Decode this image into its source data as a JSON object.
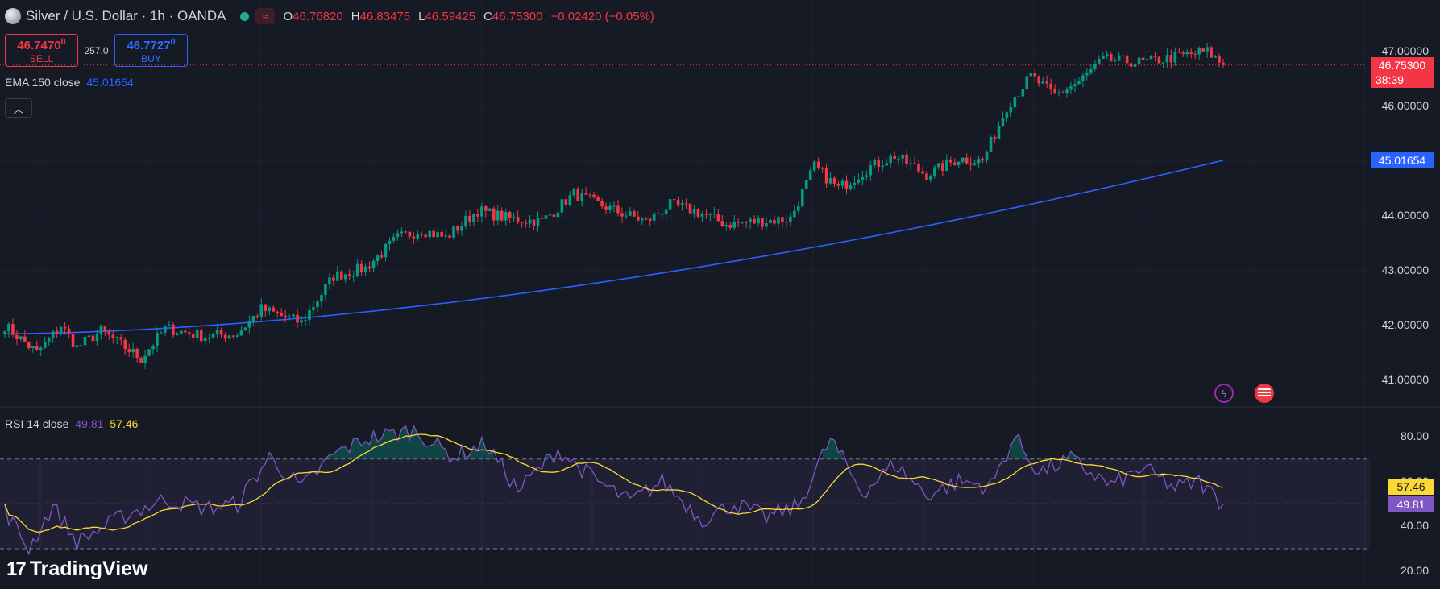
{
  "header": {
    "symbol_title": "Silver / U.S. Dollar · 1h · OANDA",
    "ohlc": [
      {
        "k": "O",
        "v": "46.76820"
      },
      {
        "k": "H",
        "v": "46.83475"
      },
      {
        "k": "L",
        "v": "46.59425"
      },
      {
        "k": "C",
        "v": "46.75300"
      }
    ],
    "change": "−0.02420 (−0.05%)",
    "market_icon": "market-open-dot",
    "data_icon": "delayed-data-icon"
  },
  "trade": {
    "sell_price": "46.7470",
    "sell_price_small": "0",
    "sell_label": "SELL",
    "spread": "257.0",
    "buy_price": "46.7727",
    "buy_price_small": "0",
    "buy_label": "BUY"
  },
  "ema": {
    "label": "EMA 150 close",
    "value": "45.01654"
  },
  "rsi": {
    "label": "RSI 14 close",
    "value": "49.81",
    "ma_value": "57.46"
  },
  "price_axis": [
    "47.00000",
    "46.00000",
    "45.00000",
    "44.00000",
    "43.00000",
    "42.00000",
    "41.00000"
  ],
  "rsi_axis": [
    "80.00",
    "60.00",
    "40.00",
    "20.00"
  ],
  "last_price_badge": {
    "price": "46.75300",
    "countdown": "38:39"
  },
  "ema_badge": "45.01654",
  "rsi_badges": {
    "ma": "57.46",
    "rsi": "49.81"
  },
  "logo_text": "TradingView",
  "colors": {
    "background": "#161a25",
    "up": "#089981",
    "down": "#f23645",
    "ema": "#2962ff",
    "rsi": "#7e57c2",
    "rsi_ma": "#fdd835"
  },
  "chart_data": {
    "type": "candlestick",
    "symbol": "XAGUSD",
    "interval": "1h",
    "ylim": [
      40.5,
      47.5
    ],
    "ema_period": 150,
    "ema_last": 45.01654,
    "last_close": 46.753,
    "ohlc_anchors": [
      {
        "bar": 0,
        "close": 42.0
      },
      {
        "bar": 8,
        "close": 41.5
      },
      {
        "bar": 14,
        "close": 42.0
      },
      {
        "bar": 18,
        "close": 41.6
      },
      {
        "bar": 24,
        "close": 41.9
      },
      {
        "bar": 34,
        "close": 41.4
      },
      {
        "bar": 40,
        "close": 41.95
      },
      {
        "bar": 50,
        "close": 41.8
      },
      {
        "bar": 58,
        "close": 41.85
      },
      {
        "bar": 64,
        "close": 42.3
      },
      {
        "bar": 74,
        "close": 42.05
      },
      {
        "bar": 82,
        "close": 42.9
      },
      {
        "bar": 90,
        "close": 43.05
      },
      {
        "bar": 98,
        "close": 43.6
      },
      {
        "bar": 104,
        "close": 43.75
      },
      {
        "bar": 110,
        "close": 43.6
      },
      {
        "bar": 118,
        "close": 44.1
      },
      {
        "bar": 126,
        "close": 43.95
      },
      {
        "bar": 134,
        "close": 43.9
      },
      {
        "bar": 142,
        "close": 44.4
      },
      {
        "bar": 152,
        "close": 44.1
      },
      {
        "bar": 160,
        "close": 43.9
      },
      {
        "bar": 166,
        "close": 44.2
      },
      {
        "bar": 172,
        "close": 44.1
      },
      {
        "bar": 180,
        "close": 43.85
      },
      {
        "bar": 188,
        "close": 43.9
      },
      {
        "bar": 196,
        "close": 43.95
      },
      {
        "bar": 202,
        "close": 44.9
      },
      {
        "bar": 208,
        "close": 44.5
      },
      {
        "bar": 216,
        "close": 44.9
      },
      {
        "bar": 222,
        "close": 45.1
      },
      {
        "bar": 230,
        "close": 44.75
      },
      {
        "bar": 238,
        "close": 45.05
      },
      {
        "bar": 244,
        "close": 45.0
      },
      {
        "bar": 250,
        "close": 46.0
      },
      {
        "bar": 256,
        "close": 46.55
      },
      {
        "bar": 262,
        "close": 46.2
      },
      {
        "bar": 268,
        "close": 46.45
      },
      {
        "bar": 274,
        "close": 46.85
      },
      {
        "bar": 284,
        "close": 46.8
      },
      {
        "bar": 292,
        "close": 46.9
      },
      {
        "bar": 300,
        "close": 47.0
      },
      {
        "bar": 304,
        "close": 46.75
      }
    ],
    "rsi_anchors": [
      {
        "bar": 0,
        "rsi": 47
      },
      {
        "bar": 6,
        "rsi": 30
      },
      {
        "bar": 12,
        "rsi": 49
      },
      {
        "bar": 18,
        "rsi": 33
      },
      {
        "bar": 30,
        "rsi": 45
      },
      {
        "bar": 40,
        "rsi": 52
      },
      {
        "bar": 50,
        "rsi": 48
      },
      {
        "bar": 58,
        "rsi": 50
      },
      {
        "bar": 66,
        "rsi": 71
      },
      {
        "bar": 74,
        "rsi": 57
      },
      {
        "bar": 82,
        "rsi": 72
      },
      {
        "bar": 90,
        "rsi": 79
      },
      {
        "bar": 102,
        "rsi": 83
      },
      {
        "bar": 112,
        "rsi": 71
      },
      {
        "bar": 120,
        "rsi": 77
      },
      {
        "bar": 128,
        "rsi": 56
      },
      {
        "bar": 138,
        "rsi": 74
      },
      {
        "bar": 148,
        "rsi": 60
      },
      {
        "bar": 156,
        "rsi": 51
      },
      {
        "bar": 164,
        "rsi": 60
      },
      {
        "bar": 174,
        "rsi": 43
      },
      {
        "bar": 182,
        "rsi": 50
      },
      {
        "bar": 190,
        "rsi": 44
      },
      {
        "bar": 198,
        "rsi": 49
      },
      {
        "bar": 206,
        "rsi": 79
      },
      {
        "bar": 214,
        "rsi": 55
      },
      {
        "bar": 222,
        "rsi": 68
      },
      {
        "bar": 230,
        "rsi": 54
      },
      {
        "bar": 238,
        "rsi": 60
      },
      {
        "bar": 246,
        "rsi": 58
      },
      {
        "bar": 252,
        "rsi": 80
      },
      {
        "bar": 258,
        "rsi": 64
      },
      {
        "bar": 266,
        "rsi": 70
      },
      {
        "bar": 276,
        "rsi": 58
      },
      {
        "bar": 284,
        "rsi": 66
      },
      {
        "bar": 292,
        "rsi": 57
      },
      {
        "bar": 298,
        "rsi": 60
      },
      {
        "bar": 304,
        "rsi": 49.81
      }
    ],
    "rsi_ylim": [
      15,
      87
    ],
    "rsi_band": [
      30,
      70
    ]
  }
}
